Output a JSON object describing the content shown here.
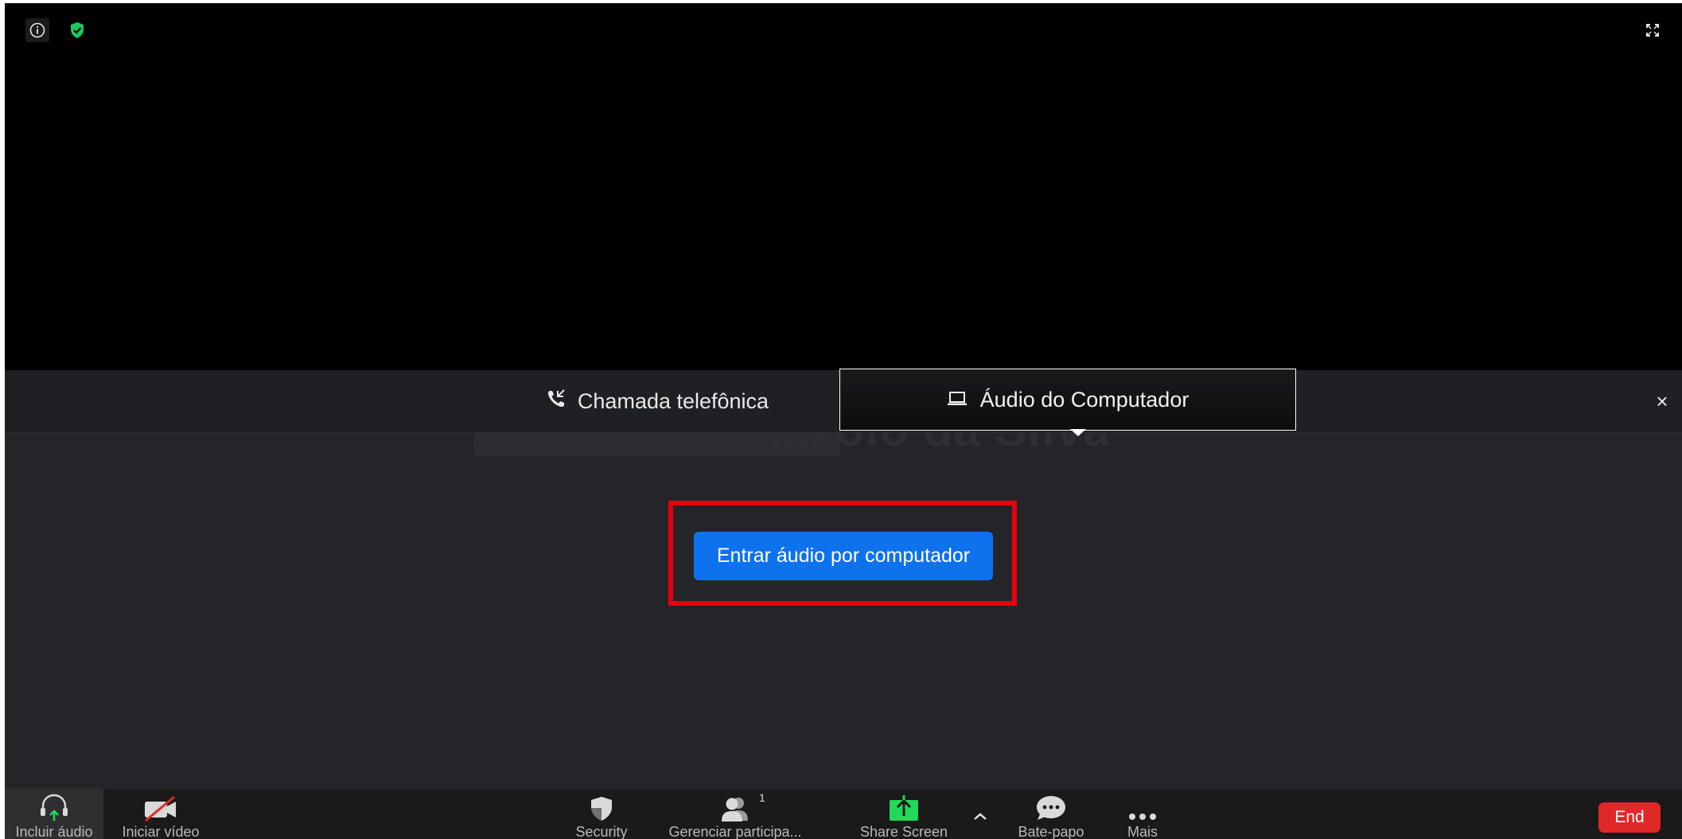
{
  "tabs": {
    "phone_label": "Chamada telefônica",
    "computer_label": "Áudio do Computador"
  },
  "dialog": {
    "join_button_label": "Entrar áudio por computador",
    "close_glyph": "×",
    "background_name": "...zolo da Silva"
  },
  "toolbar": {
    "audio_label": "Incluir áudio",
    "video_label": "Iniciar vídeo",
    "security_label": "Security",
    "participants_label": "Gerenciar participa...",
    "participants_count": "1",
    "share_label": "Share Screen",
    "chat_label": "Bate-papo",
    "more_label": "Mais",
    "end_label": "End"
  },
  "colors": {
    "accent_blue": "#0e72ed",
    "end_red": "#e02828",
    "highlight_red": "#e8000c",
    "share_green": "#23d959",
    "shield_green": "#1ec760"
  },
  "icons": [
    "info-icon",
    "shield-check-icon",
    "fullscreen-icon",
    "phone-icon",
    "laptop-icon",
    "close-icon",
    "headphones-icon",
    "video-off-icon",
    "security-shield-icon",
    "participants-icon",
    "share-screen-icon",
    "chevron-up-icon",
    "chat-icon",
    "more-icon"
  ]
}
